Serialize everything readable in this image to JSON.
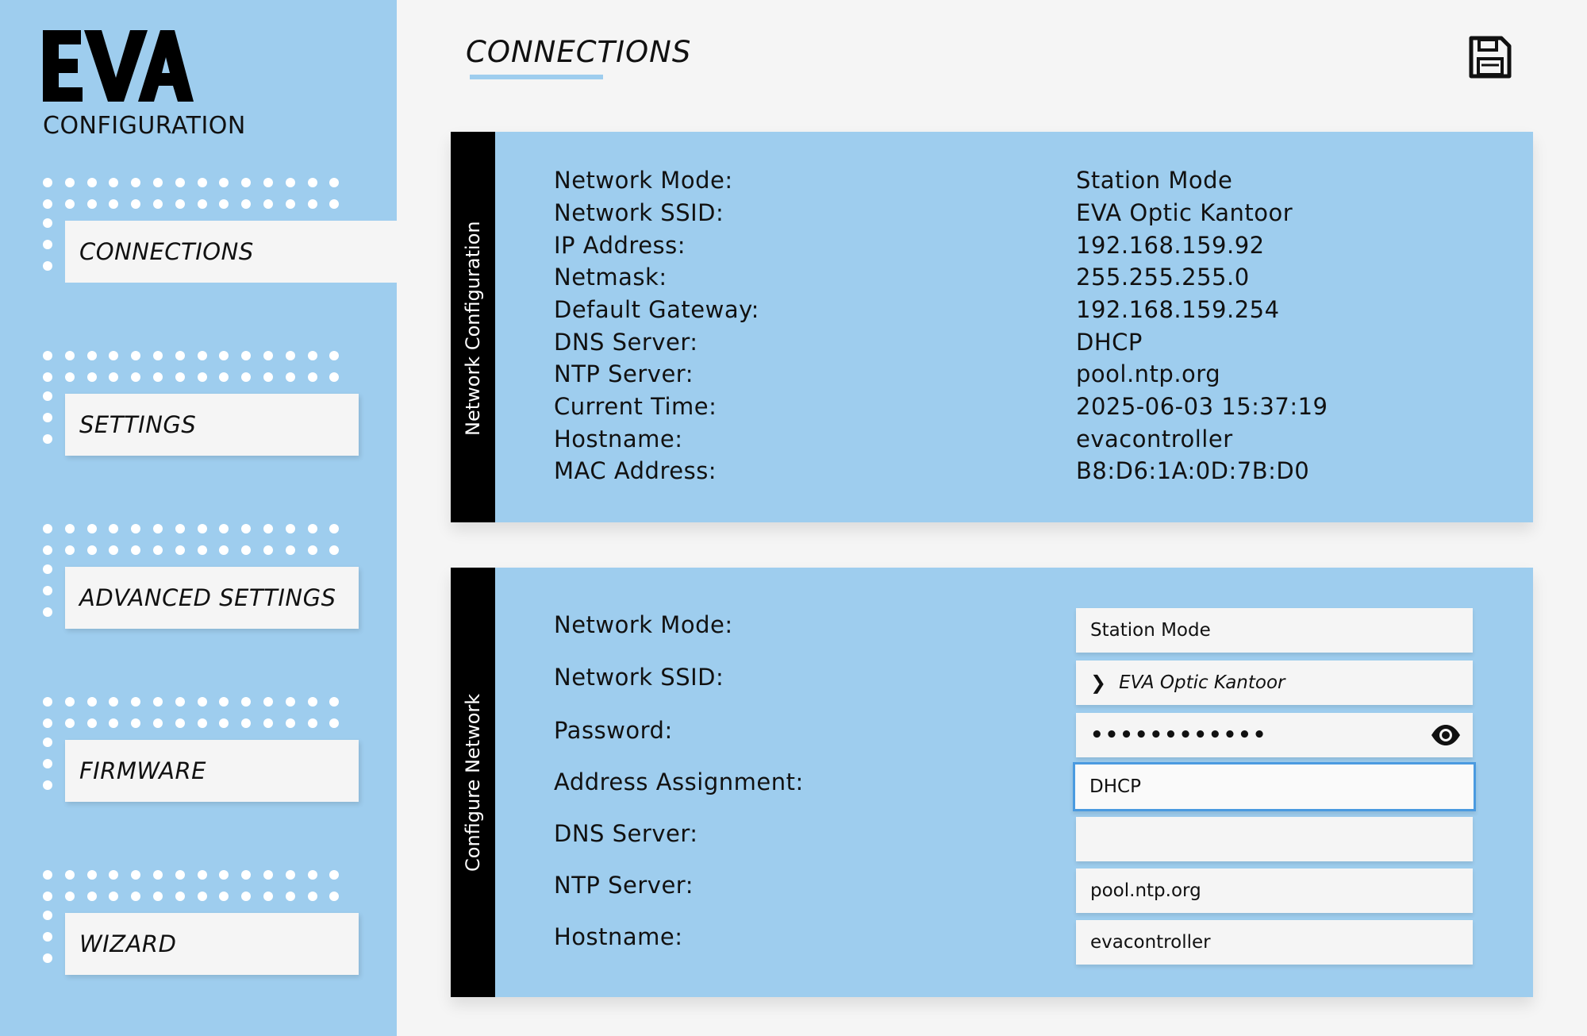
{
  "sidebar": {
    "logo_text": "EVA",
    "logo_subtitle": "CONFIGURATION",
    "items": [
      {
        "label": "CONNECTIONS",
        "active": true
      },
      {
        "label": "SETTINGS",
        "active": false
      },
      {
        "label": "ADVANCED SETTINGS",
        "active": false
      },
      {
        "label": "FIRMWARE",
        "active": false
      },
      {
        "label": "WIZARD",
        "active": false
      }
    ]
  },
  "header": {
    "title": "CONNECTIONS",
    "save_icon": "save-icon"
  },
  "network_config": {
    "tab_label": "Network Configuration",
    "rows": [
      {
        "label": "Network Mode:",
        "value": "Station Mode"
      },
      {
        "label": "Network SSID:",
        "value": "EVA Optic Kantoor"
      },
      {
        "label": "IP Address:",
        "value": "192.168.159.92"
      },
      {
        "label": "Netmask:",
        "value": "255.255.255.0"
      },
      {
        "label": "Default Gateway:",
        "value": "192.168.159.254"
      },
      {
        "label": "DNS Server:",
        "value": "DHCP"
      },
      {
        "label": "NTP Server:",
        "value": "pool.ntp.org"
      },
      {
        "label": "Current Time:",
        "value": "2025-06-03 15:37:19"
      },
      {
        "label": "Hostname:",
        "value": "evacontroller"
      },
      {
        "label": "MAC Address:",
        "value": "B8:D6:1A:0D:7B:D0"
      }
    ]
  },
  "configure_network": {
    "tab_label": "Configure Network",
    "fields": {
      "network_mode": {
        "label": "Network Mode:",
        "value": "Station Mode"
      },
      "network_ssid": {
        "label": "Network SSID:",
        "chevron": "❯",
        "value": "EVA Optic Kantoor"
      },
      "password": {
        "label": "Password:",
        "value": "••••••••••••"
      },
      "address_assignment": {
        "label": "Address Assignment:",
        "value": "DHCP"
      },
      "dns_server": {
        "label": "DNS Server:",
        "value": ""
      },
      "ntp_server": {
        "label": "NTP Server:",
        "value": "pool.ntp.org"
      },
      "hostname": {
        "label": "Hostname:",
        "value": "evacontroller"
      }
    }
  },
  "colors": {
    "accent": "#9ecdee",
    "panel_tab": "#000000",
    "focus_border": "#4a9ae0",
    "background": "#f5f5f5"
  }
}
